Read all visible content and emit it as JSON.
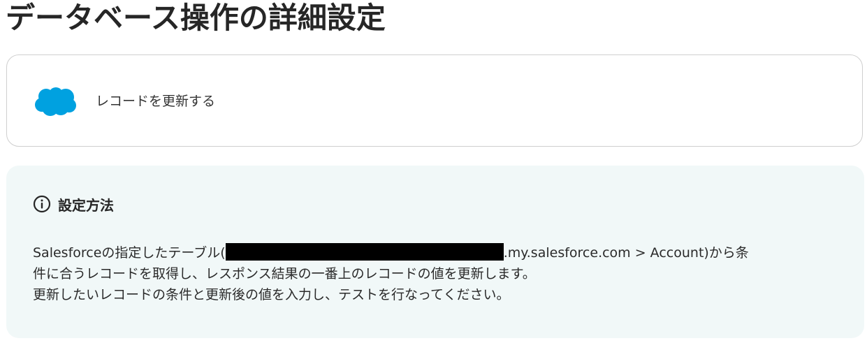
{
  "page": {
    "title": "データベース操作の詳細設定"
  },
  "action": {
    "app_icon": "salesforce-cloud-icon",
    "label": "レコードを更新する"
  },
  "info": {
    "icon": "info-circle-icon",
    "title": "設定方法",
    "line1_prefix": "Salesforceの指定したテーブル(",
    "line1_suffix": ".my.salesforce.com > Account)から条",
    "line2": "件に合うレコードを取得し、レスポンス結果の一番上のレコードの値を更新します。",
    "line3": "更新したいレコードの条件と更新後の値を入力し、テストを行なってください。"
  },
  "colors": {
    "salesforce_blue": "#00a1e0",
    "panel_background": "#f1f8f8",
    "card_border": "#cfcfcf"
  }
}
